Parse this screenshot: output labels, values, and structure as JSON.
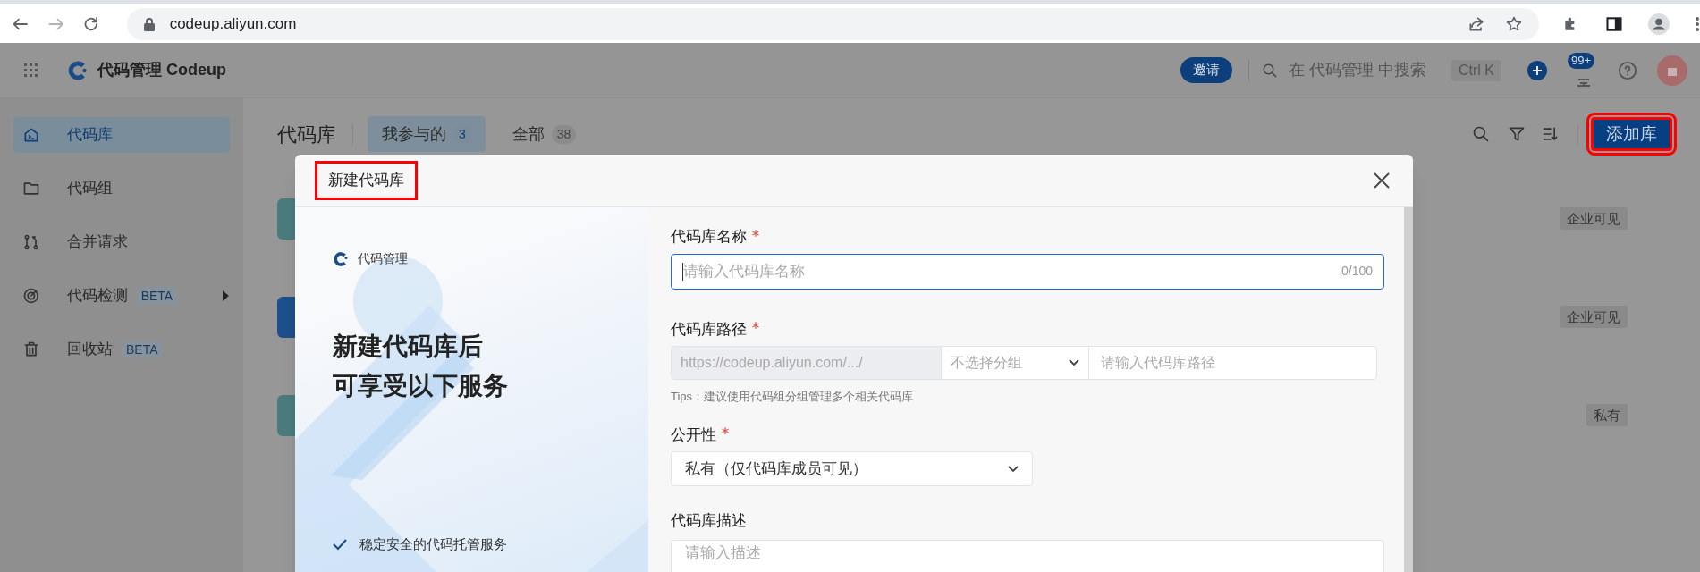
{
  "browser": {
    "url": "codeup.aliyun.com"
  },
  "header": {
    "product": "代码管理 Codeup",
    "invite": "邀请",
    "search_placeholder": "在 代码管理 中搜索",
    "shortcut": "Ctrl K",
    "notification_badge": "99+"
  },
  "sidebar": {
    "items": [
      {
        "kind": "repo",
        "label": "代码库",
        "selected": true
      },
      {
        "kind": "group",
        "label": "代码组",
        "selected": false
      },
      {
        "kind": "merge",
        "label": "合并请求",
        "selected": false
      },
      {
        "kind": "scan",
        "label": "代码检测",
        "badge": "BETA",
        "expandable": true,
        "selected": false
      },
      {
        "kind": "trash",
        "label": "回收站",
        "badge": "BETA",
        "selected": false
      }
    ]
  },
  "page": {
    "title": "代码库",
    "tabs": [
      {
        "label": "我参与的",
        "count": "3",
        "selected": true
      },
      {
        "label": "全部",
        "count": "38",
        "selected": false
      }
    ],
    "add_button": {
      "label": "添加库",
      "highlighted": true
    },
    "repos": [
      {
        "color": "#4a7b7d",
        "tag": "企业可见"
      },
      {
        "color": "#1d4f8c",
        "tag": "企业可见"
      },
      {
        "color": "#4a7b7d",
        "tag": "私有"
      }
    ]
  },
  "modal": {
    "title": "新建代码库",
    "title_highlighted": true,
    "brand": "代码管理",
    "headline": [
      "新建代码库后",
      "可享受以下服务"
    ],
    "features": [
      "稳定安全的代码托管服务"
    ],
    "name_field": {
      "label": "代码库名称",
      "required": true,
      "placeholder": "请输入代码库名称",
      "counter": "0/100",
      "focused": true
    },
    "path_field": {
      "label": "代码库路径",
      "required": true,
      "prefix": "https://codeup.aliyun.com/.../",
      "group_placeholder": "不选择分组",
      "placeholder": "请输入代码库路径",
      "tips": "Tips：建议使用代码组分组管理多个相关代码库"
    },
    "visibility_field": {
      "label": "公开性",
      "required": true,
      "value": "私有（仅代码库成员可见）"
    },
    "description_field": {
      "label": "代码库描述",
      "required": false,
      "placeholder": "请输入描述"
    }
  }
}
